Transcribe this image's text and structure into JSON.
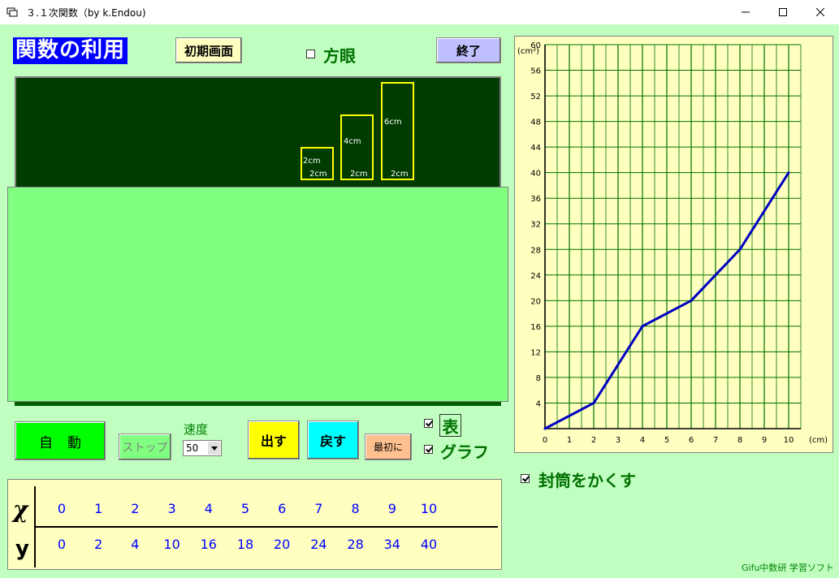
{
  "window": {
    "title": "３.１次関数（by k.Endou)"
  },
  "header": {
    "app_title": "関数の利用",
    "init_button": "初期画面",
    "grid_checkbox_label": "方眼",
    "grid_checked": false,
    "exit_button": "終了"
  },
  "scene": {
    "rectangles": [
      {
        "label_side": "2cm",
        "label_bottom": "2cm"
      },
      {
        "label_side": "4cm",
        "label_bottom": "2cm"
      },
      {
        "label_side": "6cm",
        "label_bottom": "2cm"
      }
    ]
  },
  "controls": {
    "auto_button": "自動",
    "stop_button": "ストップ",
    "speed_label": "速度",
    "speed_value": "50",
    "out_button": "出す",
    "back_button": "戻す",
    "first_button": "最初に",
    "table_checkbox_label": "表",
    "table_checked": true,
    "graph_checkbox_label": "グラフ",
    "graph_checked": true,
    "hide_envelope_label": "封筒をかくす",
    "hide_envelope_checked": true
  },
  "table": {
    "x_label": "χ",
    "y_label": "y",
    "x_values": [
      "0",
      "1",
      "2",
      "3",
      "4",
      "5",
      "6",
      "7",
      "8",
      "9",
      "10"
    ],
    "y_values": [
      "0",
      "2",
      "4",
      "10",
      "16",
      "18",
      "20",
      "24",
      "28",
      "34",
      "40"
    ]
  },
  "chart_data": {
    "type": "line",
    "x": [
      0,
      2,
      4,
      6,
      8,
      10
    ],
    "series": [
      {
        "values": [
          0,
          4,
          16,
          20,
          28,
          40
        ]
      }
    ],
    "xlim": [
      0,
      10
    ],
    "ylim": [
      0,
      60
    ],
    "x_ticks": [
      "0",
      "1",
      "2",
      "3",
      "4",
      "5",
      "6",
      "7",
      "8",
      "9",
      "10"
    ],
    "y_ticks": [
      "4",
      "8",
      "12",
      "16",
      "20",
      "24",
      "28",
      "32",
      "36",
      "40",
      "44",
      "48",
      "52",
      "56",
      "60"
    ],
    "xlabel": "(cm)",
    "ylabel": "(cm²)",
    "grid": true,
    "line_color": "#0000c0",
    "grid_color": "#007000"
  },
  "footer": {
    "credit": "Gifu中数研 学習ソフト"
  },
  "colors": {
    "background": "#c0ffc0",
    "scene_dark": "#003c00",
    "scene_light": "#80ff80",
    "rect_outline": "#ffff00"
  }
}
